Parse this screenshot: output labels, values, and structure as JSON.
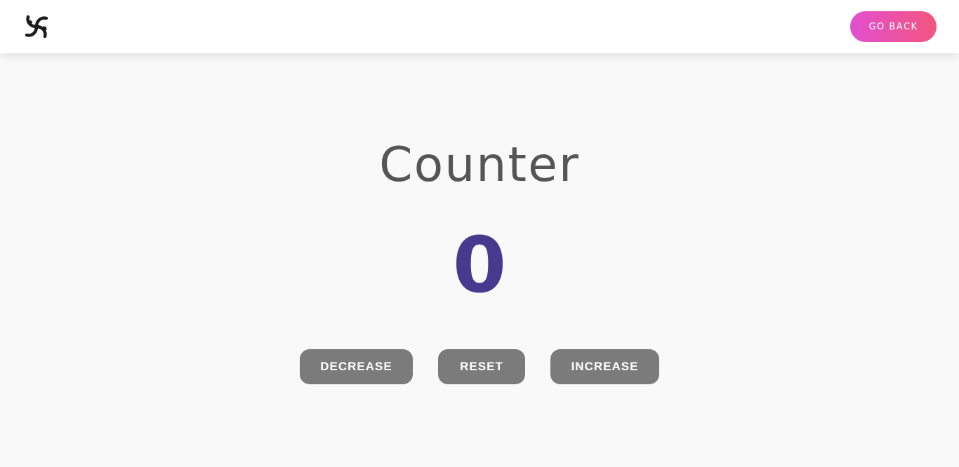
{
  "navbar": {
    "logo_icon": "swirl-logo-icon",
    "go_back_label": "GO BACK",
    "go_back_gradient": [
      "#e24fd0",
      "#f2557e"
    ]
  },
  "main": {
    "title": "Counter",
    "count": "0",
    "count_color": "#47398e",
    "buttons": {
      "decrease": "DECREASE",
      "reset": "RESET",
      "increase": "INCREASE"
    },
    "button_color": "#7b7b7b"
  }
}
